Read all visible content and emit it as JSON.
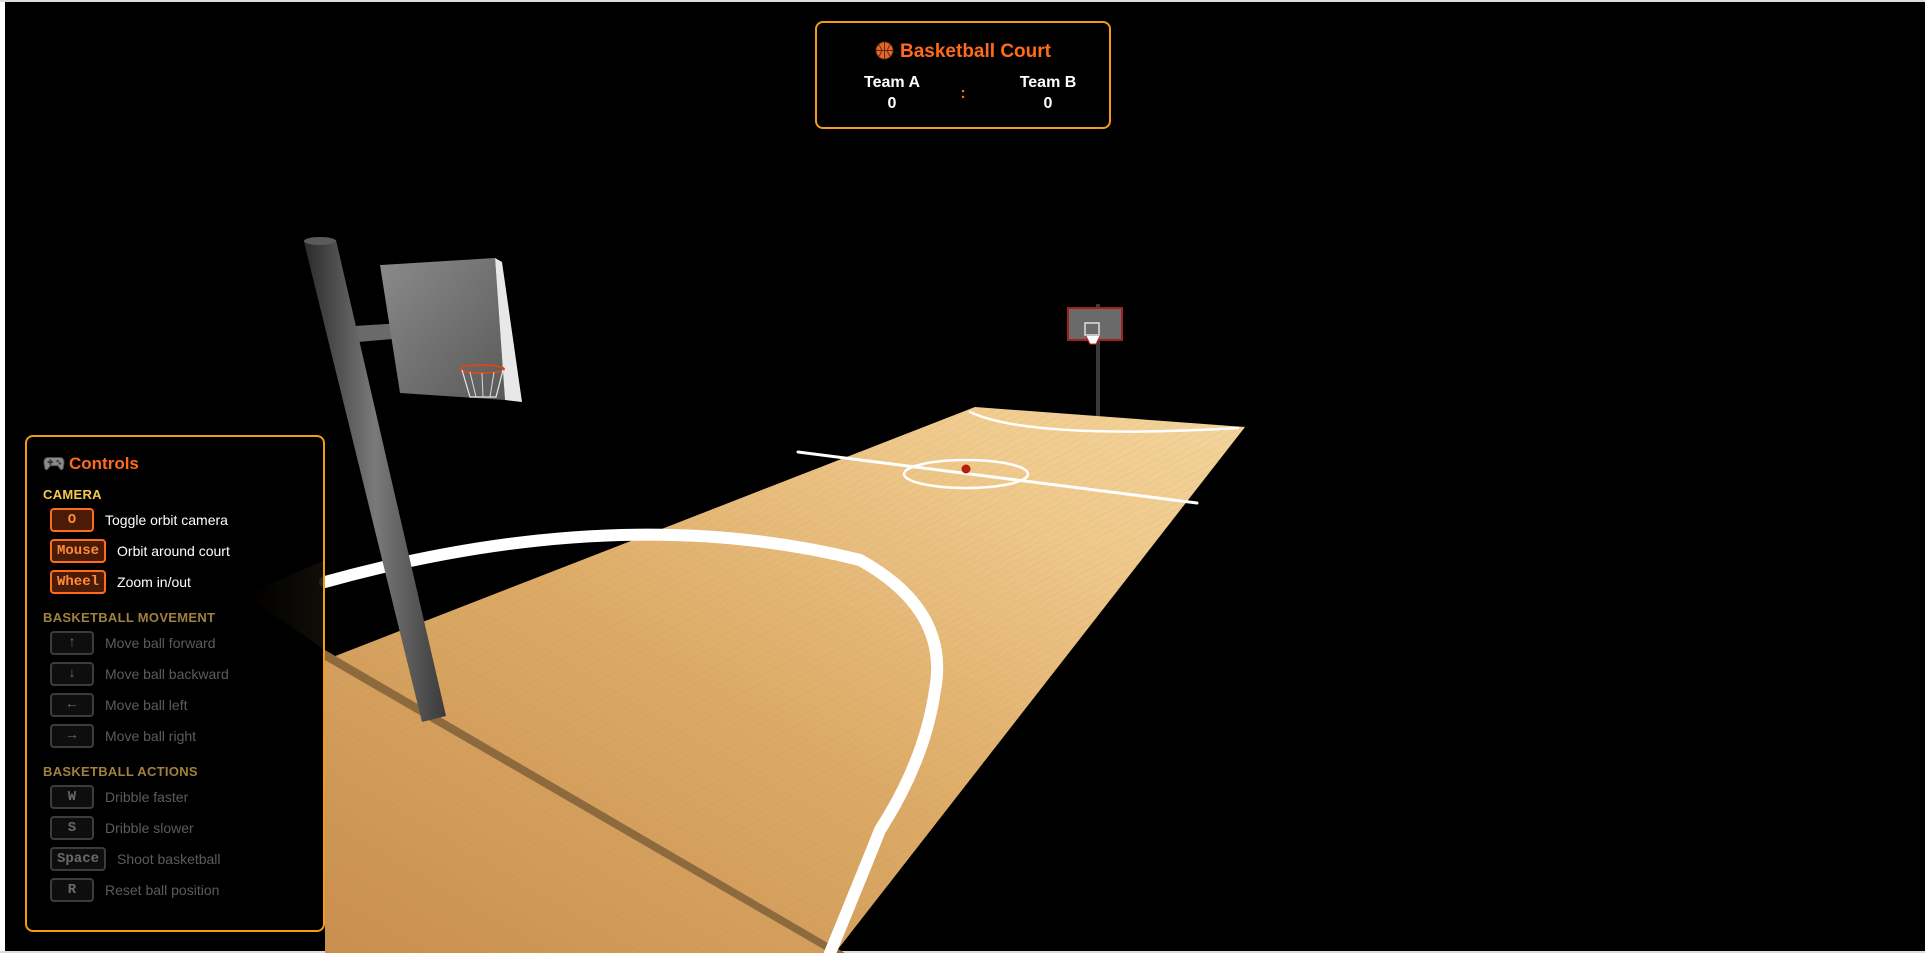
{
  "scoreboard": {
    "title": "Basketball Court",
    "title_icon": "basketball-icon",
    "separator": ":",
    "team_a": {
      "name": "Team A",
      "score": "0"
    },
    "team_b": {
      "name": "Team B",
      "score": "0"
    }
  },
  "controls": {
    "title": "Controls",
    "title_icon": "gamepad-icon",
    "sections": [
      {
        "heading": "CAMERA",
        "active": true,
        "items": [
          {
            "key": "O",
            "label": "Toggle orbit camera"
          },
          {
            "key": "Mouse",
            "label": "Orbit around court"
          },
          {
            "key": "Wheel",
            "label": "Zoom in/out"
          }
        ]
      },
      {
        "heading": "BASKETBALL MOVEMENT",
        "active": false,
        "items": [
          {
            "key": "↑",
            "label": "Move ball forward"
          },
          {
            "key": "↓",
            "label": "Move ball backward"
          },
          {
            "key": "←",
            "label": "Move ball left"
          },
          {
            "key": "→",
            "label": "Move ball right"
          }
        ]
      },
      {
        "heading": "BASKETBALL ACTIONS",
        "active": false,
        "items": [
          {
            "key": "W",
            "label": "Dribble faster"
          },
          {
            "key": "S",
            "label": "Dribble slower"
          },
          {
            "key": "Space",
            "label": "Shoot basketball"
          },
          {
            "key": "R",
            "label": "Reset ball position"
          }
        ]
      }
    ]
  },
  "colors": {
    "accent": "#ff6b1a",
    "border": "#f39c12",
    "section_heading": "#f5c94a",
    "court_wood": "#d9a865",
    "court_line": "#ffffff",
    "background": "#000000"
  }
}
